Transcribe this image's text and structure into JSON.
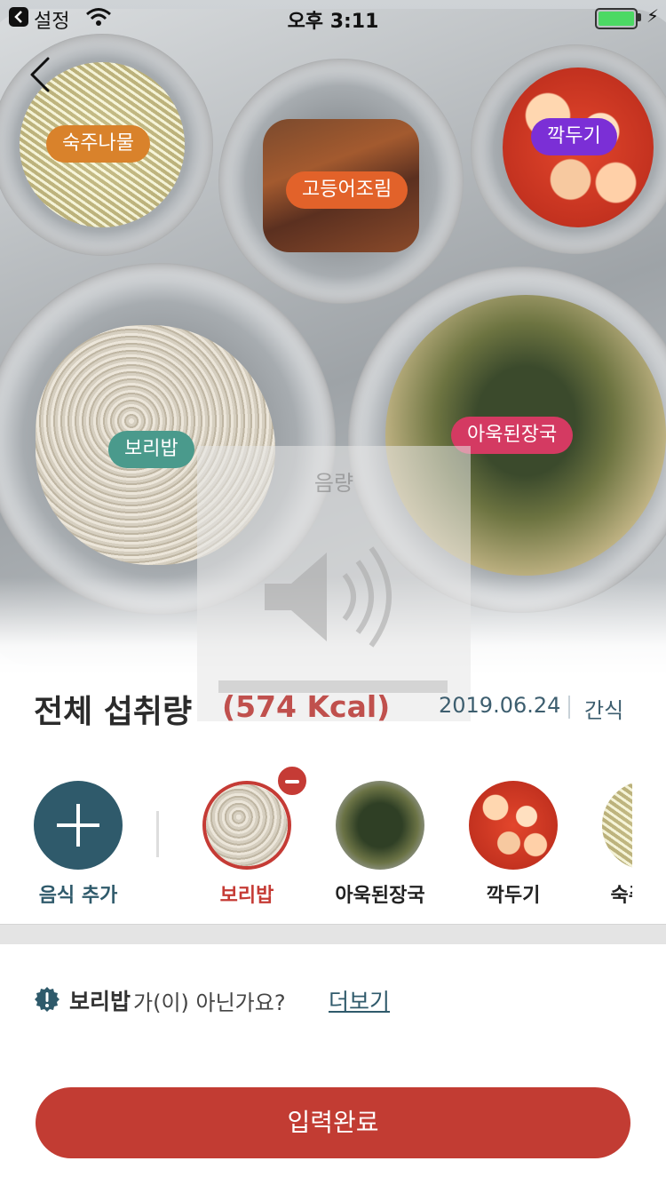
{
  "status_bar": {
    "back_app": "설정",
    "time": "오후 3:11"
  },
  "photo": {
    "tags": {
      "sprouts": "숙주나물",
      "fish": "고등어조림",
      "kimchi": "깍두기",
      "rice": "보리밥",
      "soup": "아욱된장국"
    },
    "volume_overlay_label": "음량"
  },
  "summary": {
    "title": "전체 섭취량",
    "kcal": "(574 Kcal)",
    "date": "2019.06.24",
    "meal": "간식"
  },
  "add_food": {
    "label": "음식 추가"
  },
  "items": [
    {
      "label": "보리밥",
      "selected": true
    },
    {
      "label": "아욱된장국",
      "selected": false
    },
    {
      "label": "깍두기",
      "selected": false
    },
    {
      "label": "숙주나물",
      "selected": false
    }
  ],
  "question": {
    "food": "보리밥",
    "text": "가(이) 아닌가요?",
    "link": "더보기"
  },
  "submit_label": "입력완료",
  "colors": {
    "primary": "#2f5a6b",
    "accent": "#c23c33"
  }
}
